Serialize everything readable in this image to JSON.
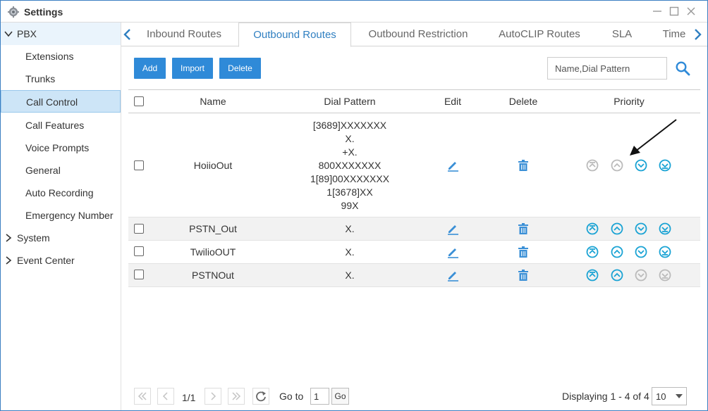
{
  "window": {
    "title": "Settings"
  },
  "sidebar": {
    "groups": [
      {
        "label": "PBX",
        "expanded": true
      },
      {
        "label": "System",
        "expanded": false
      },
      {
        "label": "Event Center",
        "expanded": false
      }
    ],
    "pbx_items": [
      "Extensions",
      "Trunks",
      "Call Control",
      "Call Features",
      "Voice Prompts",
      "General",
      "Auto Recording",
      "Emergency Number"
    ],
    "active_item": "Call Control"
  },
  "tabs": [
    "Inbound Routes",
    "Outbound Routes",
    "Outbound Restriction",
    "AutoCLIP Routes",
    "SLA",
    "Time"
  ],
  "active_tab": "Outbound Routes",
  "toolbar": {
    "add_label": "Add",
    "import_label": "Import",
    "delete_label": "Delete",
    "search_placeholder": "Name,Dial Pattern"
  },
  "table": {
    "headers": {
      "name": "Name",
      "dial_pattern": "Dial Pattern",
      "edit": "Edit",
      "delete": "Delete",
      "priority": "Priority"
    },
    "rows": [
      {
        "name": "HoiioOut",
        "dial_pattern": [
          "[3689]XXXXXXX",
          "X.",
          "+X.",
          "800XXXXXXX",
          "1[89]00XXXXXXX",
          "1[3678]XX",
          "99X"
        ],
        "priority": {
          "top": false,
          "up": false,
          "down": true,
          "bottom": true
        }
      },
      {
        "name": "PSTN_Out",
        "dial_pattern": [
          "X."
        ],
        "priority": {
          "top": true,
          "up": true,
          "down": true,
          "bottom": true
        }
      },
      {
        "name": "TwilioOUT",
        "dial_pattern": [
          "X."
        ],
        "priority": {
          "top": true,
          "up": true,
          "down": true,
          "bottom": true
        }
      },
      {
        "name": "PSTNOut",
        "dial_pattern": [
          "X."
        ],
        "priority": {
          "top": true,
          "up": true,
          "down": false,
          "bottom": false
        }
      }
    ]
  },
  "pager": {
    "page": "1/1",
    "goto_label": "Go to",
    "goto_value": "1",
    "go_label": "Go",
    "displaying": "Displaying 1 - 4 of 4",
    "per_page": "10"
  },
  "colors": {
    "accent": "#2f8ad8",
    "icon_active": "#1aa3d4",
    "icon_disabled": "#bbbbbb",
    "edit_icon": "#3a8fd6"
  }
}
